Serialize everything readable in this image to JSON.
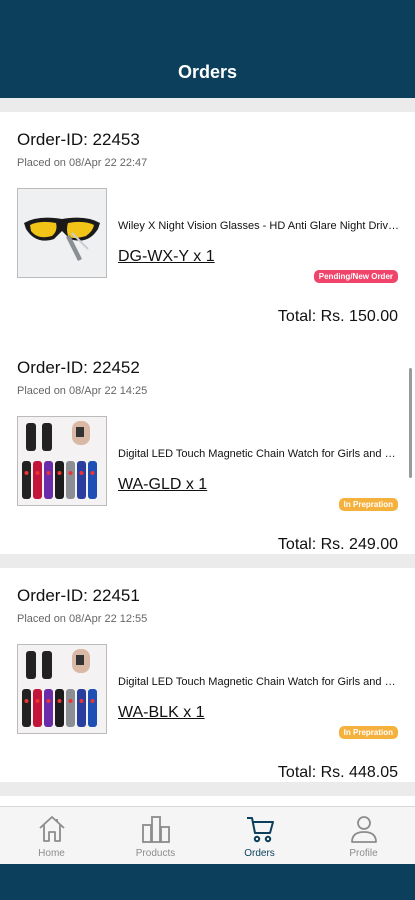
{
  "header": {
    "title": "Orders"
  },
  "orders": [
    {
      "order_id": "Order-ID: 22453",
      "placed_on": "Placed on 08/Apr 22 22:47",
      "product_name": "Wiley X Night Vision Glasses - HD Anti Glare Night Driving Glasses",
      "sku_qty": "DG-WX-Y x 1",
      "status": "Pending/New Order",
      "status_color": "#f0446a",
      "total": "Total: Rs. 150.00"
    },
    {
      "order_id": "Order-ID: 22452",
      "placed_on": "Placed on 08/Apr 22 14:25",
      "product_name": "Digital LED Touch Magnetic Chain Watch for Girls and Boys",
      "sku_qty": "WA-GLD x 1",
      "status": "In Prepration",
      "status_color": "#f5b13d",
      "total": "Total: Rs. 249.00"
    },
    {
      "order_id": "Order-ID: 22451",
      "placed_on": "Placed on 08/Apr 22 12:55",
      "product_name": "Digital LED Touch Magnetic Chain Watch for Girls and Boys",
      "sku_qty": "WA-BLK x 1",
      "status": "In Prepration",
      "status_color": "#f5b13d",
      "total": "Total: Rs. 448.05"
    }
  ],
  "nav": {
    "home": "Home",
    "products": "Products",
    "orders": "Orders",
    "profile": "Profile",
    "active": "orders"
  },
  "colors": {
    "brand": "#0b3f5c",
    "background": "#ebebeb"
  }
}
